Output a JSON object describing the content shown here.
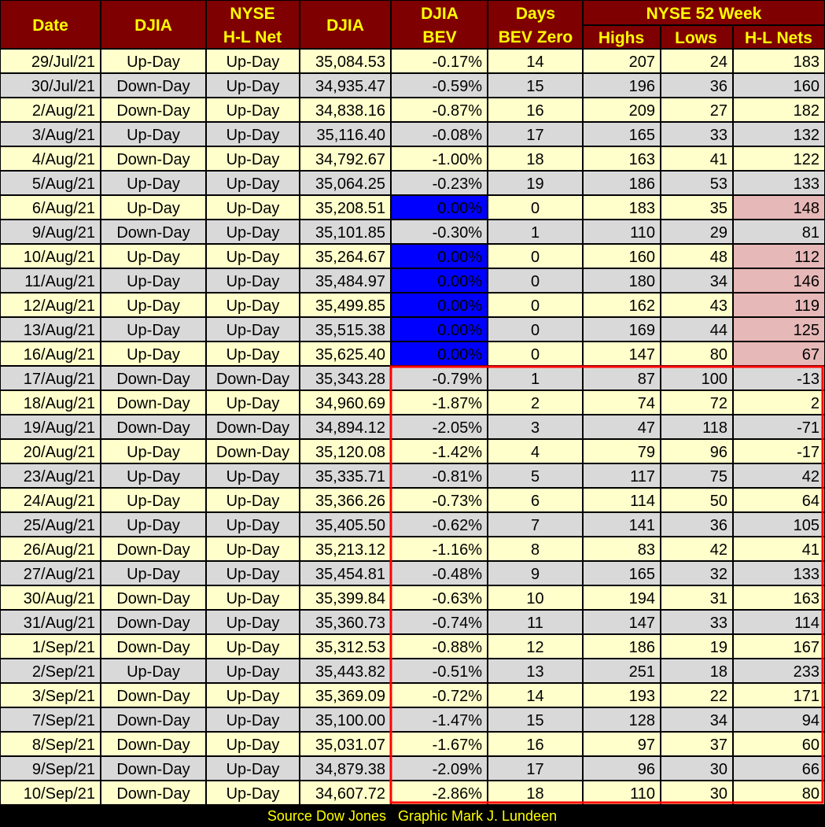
{
  "header": {
    "date": "Date",
    "djia_day": "DJIA",
    "nyse_hl_line1": "NYSE",
    "nyse_hl_line2": "H-L Net",
    "djia_close": "DJIA",
    "bev_line1": "DJIA",
    "bev_line2": "BEV",
    "days_line1": "Days",
    "days_line2": "BEV Zero",
    "nyse52_group": "NYSE 52 Week",
    "highs": "Highs",
    "lows": "Lows",
    "hl_nets": "H-L Nets"
  },
  "source_note": "Source Dow Jones   Graphic Mark J. Lundeen",
  "highlighted_rows_start": "17/Aug/21",
  "colors": {
    "background": "#000000",
    "header_bg": "#7f0000",
    "header_text": "#ffff00",
    "row_light": "#ffffcc",
    "row_gray": "#d9d9d9",
    "bev_zero_bg": "#0000ff",
    "bev_zero_text": "#ffffff",
    "hl_net_pink": "#e6b8b7",
    "highlight_border": "#ff0000"
  },
  "chart_data": {
    "type": "table",
    "columns": [
      "Date",
      "DJIA",
      "NYSE H-L Net",
      "DJIA",
      "DJIA BEV",
      "Days BEV Zero",
      "Highs",
      "Lows",
      "H-L Nets"
    ],
    "rows": [
      [
        "29/Jul/21",
        "Up-Day",
        "Up-Day",
        "35,084.53",
        "-0.17%",
        "14",
        "207",
        "24",
        "183"
      ],
      [
        "30/Jul/21",
        "Down-Day",
        "Up-Day",
        "34,935.47",
        "-0.59%",
        "15",
        "196",
        "36",
        "160"
      ],
      [
        "2/Aug/21",
        "Down-Day",
        "Up-Day",
        "34,838.16",
        "-0.87%",
        "16",
        "209",
        "27",
        "182"
      ],
      [
        "3/Aug/21",
        "Up-Day",
        "Up-Day",
        "35,116.40",
        "-0.08%",
        "17",
        "165",
        "33",
        "132"
      ],
      [
        "4/Aug/21",
        "Down-Day",
        "Up-Day",
        "34,792.67",
        "-1.00%",
        "18",
        "163",
        "41",
        "122"
      ],
      [
        "5/Aug/21",
        "Up-Day",
        "Up-Day",
        "35,064.25",
        "-0.23%",
        "19",
        "186",
        "53",
        "133"
      ],
      [
        "6/Aug/21",
        "Up-Day",
        "Up-Day",
        "35,208.51",
        "0.00%",
        "0",
        "183",
        "35",
        "148"
      ],
      [
        "9/Aug/21",
        "Down-Day",
        "Up-Day",
        "35,101.85",
        "-0.30%",
        "1",
        "110",
        "29",
        "81"
      ],
      [
        "10/Aug/21",
        "Up-Day",
        "Up-Day",
        "35,264.67",
        "0.00%",
        "0",
        "160",
        "48",
        "112"
      ],
      [
        "11/Aug/21",
        "Up-Day",
        "Up-Day",
        "35,484.97",
        "0.00%",
        "0",
        "180",
        "34",
        "146"
      ],
      [
        "12/Aug/21",
        "Up-Day",
        "Up-Day",
        "35,499.85",
        "0.00%",
        "0",
        "162",
        "43",
        "119"
      ],
      [
        "13/Aug/21",
        "Up-Day",
        "Up-Day",
        "35,515.38",
        "0.00%",
        "0",
        "169",
        "44",
        "125"
      ],
      [
        "16/Aug/21",
        "Up-Day",
        "Up-Day",
        "35,625.40",
        "0.00%",
        "0",
        "147",
        "80",
        "67"
      ],
      [
        "17/Aug/21",
        "Down-Day",
        "Down-Day",
        "35,343.28",
        "-0.79%",
        "1",
        "87",
        "100",
        "-13"
      ],
      [
        "18/Aug/21",
        "Down-Day",
        "Up-Day",
        "34,960.69",
        "-1.87%",
        "2",
        "74",
        "72",
        "2"
      ],
      [
        "19/Aug/21",
        "Down-Day",
        "Down-Day",
        "34,894.12",
        "-2.05%",
        "3",
        "47",
        "118",
        "-71"
      ],
      [
        "20/Aug/21",
        "Up-Day",
        "Down-Day",
        "35,120.08",
        "-1.42%",
        "4",
        "79",
        "96",
        "-17"
      ],
      [
        "23/Aug/21",
        "Up-Day",
        "Up-Day",
        "35,335.71",
        "-0.81%",
        "5",
        "117",
        "75",
        "42"
      ],
      [
        "24/Aug/21",
        "Up-Day",
        "Up-Day",
        "35,366.26",
        "-0.73%",
        "6",
        "114",
        "50",
        "64"
      ],
      [
        "25/Aug/21",
        "Up-Day",
        "Up-Day",
        "35,405.50",
        "-0.62%",
        "7",
        "141",
        "36",
        "105"
      ],
      [
        "26/Aug/21",
        "Down-Day",
        "Up-Day",
        "35,213.12",
        "-1.16%",
        "8",
        "83",
        "42",
        "41"
      ],
      [
        "27/Aug/21",
        "Up-Day",
        "Up-Day",
        "35,454.81",
        "-0.48%",
        "9",
        "165",
        "32",
        "133"
      ],
      [
        "30/Aug/21",
        "Down-Day",
        "Up-Day",
        "35,399.84",
        "-0.63%",
        "10",
        "194",
        "31",
        "163"
      ],
      [
        "31/Aug/21",
        "Down-Day",
        "Up-Day",
        "35,360.73",
        "-0.74%",
        "11",
        "147",
        "33",
        "114"
      ],
      [
        "1/Sep/21",
        "Down-Day",
        "Up-Day",
        "35,312.53",
        "-0.88%",
        "12",
        "186",
        "19",
        "167"
      ],
      [
        "2/Sep/21",
        "Up-Day",
        "Up-Day",
        "35,443.82",
        "-0.51%",
        "13",
        "251",
        "18",
        "233"
      ],
      [
        "3/Sep/21",
        "Down-Day",
        "Up-Day",
        "35,369.09",
        "-0.72%",
        "14",
        "193",
        "22",
        "171"
      ],
      [
        "7/Sep/21",
        "Down-Day",
        "Up-Day",
        "35,100.00",
        "-1.47%",
        "15",
        "128",
        "34",
        "94"
      ],
      [
        "8/Sep/21",
        "Down-Day",
        "Up-Day",
        "35,031.07",
        "-1.67%",
        "16",
        "97",
        "37",
        "60"
      ],
      [
        "9/Sep/21",
        "Down-Day",
        "Up-Day",
        "34,879.38",
        "-2.09%",
        "17",
        "96",
        "30",
        "66"
      ],
      [
        "10/Sep/21",
        "Down-Day",
        "Up-Day",
        "34,607.72",
        "-2.86%",
        "18",
        "110",
        "30",
        "80"
      ]
    ],
    "pink_hl_net_rows": [
      "6/Aug/21",
      "10/Aug/21",
      "11/Aug/21",
      "12/Aug/21",
      "13/Aug/21",
      "16/Aug/21"
    ]
  }
}
